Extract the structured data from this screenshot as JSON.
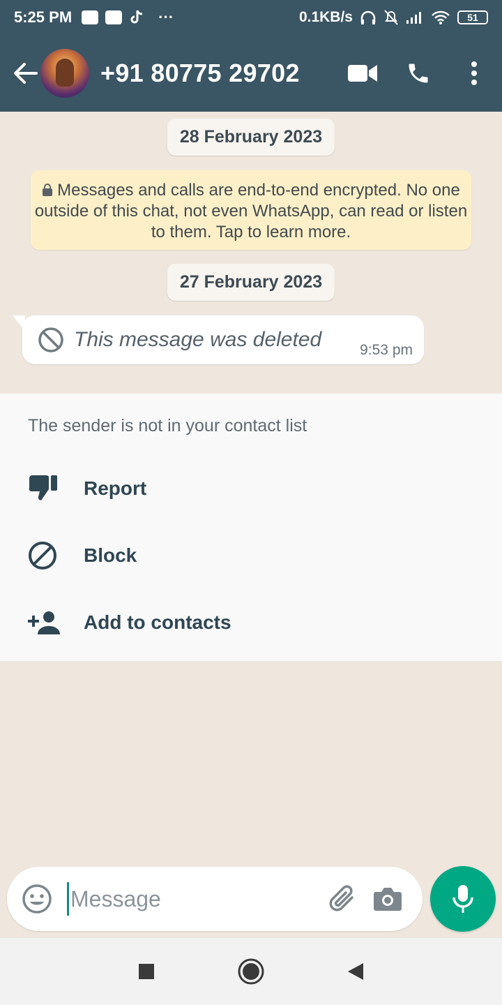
{
  "status_bar": {
    "time": "5:25 PM",
    "net_speed": "0.1KB/s",
    "dots": "···",
    "battery": "51"
  },
  "header": {
    "title": "+91 80775 29702",
    "icons": [
      "back-arrow-icon",
      "video-call-icon",
      "phone-icon",
      "more-options-icon"
    ]
  },
  "chat": {
    "date_1": "28 February 2023",
    "encryption_notice": "Messages and calls are end-to-end encrypted. No one outside of this chat, not even WhatsApp, can read or listen to them. Tap to learn more.",
    "date_2": "27 February 2023",
    "deleted_message": "This message was deleted",
    "deleted_time": "9:53 pm"
  },
  "sender_panel": {
    "note": "The sender is not in your contact list",
    "options": [
      {
        "label": "Report",
        "icon": "thumbs-down-icon"
      },
      {
        "label": "Block",
        "icon": "block-icon"
      },
      {
        "label": "Add to contacts",
        "icon": "add-contact-icon"
      }
    ]
  },
  "composer": {
    "placeholder": "Message"
  },
  "colors": {
    "header": "#3a5564",
    "accent": "#00a884",
    "chat_bg": "#efe7dd",
    "encryption_bg": "#fdf0c8"
  }
}
